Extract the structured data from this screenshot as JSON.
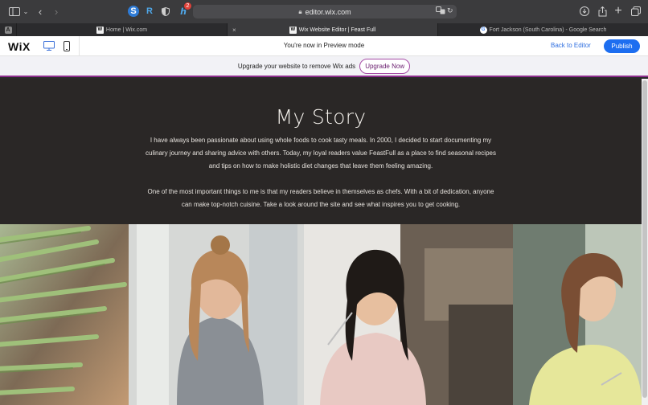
{
  "browser": {
    "url": "editor.wix.com",
    "ext_badge": "2",
    "tabs": [
      {
        "label": "Home | Wix.com",
        "favicon": "W"
      },
      {
        "label": "Wix Website Editor | Feast Full",
        "favicon": "W"
      },
      {
        "label": "Fort Jackson (South Carolina) - Google Search",
        "favicon": "G"
      }
    ],
    "pinned_tab": "A"
  },
  "wix": {
    "logo": "WiX",
    "preview_text": "You're now in Preview mode",
    "back_label": "Back to Editor",
    "publish_label": "Publish",
    "upgrade_msg": "Upgrade your website to remove Wix ads",
    "upgrade_btn": "Upgrade Now"
  },
  "site": {
    "title": "My Story",
    "paragraph1": "I have always been passionate about using whole foods to cook tasty meals. In 2000, I decided to start documenting my culinary journey and sharing advice with others. Today, my loyal readers value FeastFull as a place to find seasonal recipes and tips on how to make holistic diet changes that leave them feeling amazing.",
    "paragraph2": "One of the most important things to me is that my readers believe in themselves as chefs. With a bit of dedication, anyone can make top-notch cuisine. Take a look around the site and see what inspires you to get cooking."
  },
  "colors": {
    "accent": "#1d6ef0",
    "banner_border": "#8c2d8c",
    "site_bg": "#2a2726"
  }
}
